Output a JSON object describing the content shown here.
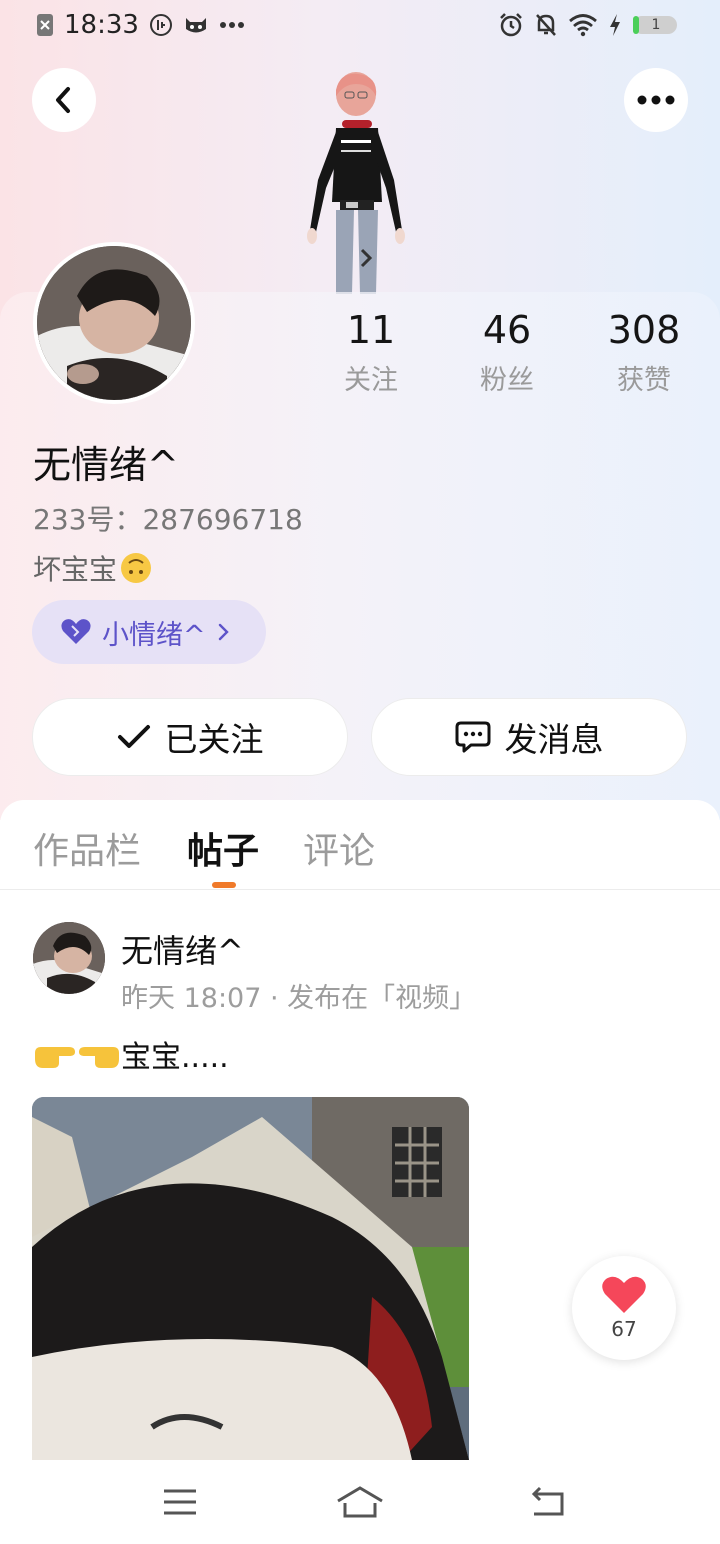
{
  "status_bar": {
    "time": "18:33",
    "battery_level": "1",
    "icons": [
      "close-square-icon",
      "app-icon",
      "cat-face-icon",
      "more-dots-icon",
      "alarm-icon",
      "bell-off-icon",
      "wifi-icon",
      "charging-icon",
      "battery-icon"
    ]
  },
  "profile": {
    "nickname": "无情绪^",
    "uid_text": "233号：287696718",
    "bio": "坏宝宝",
    "bio_emoji": "upside-down-face",
    "tag_label": "小情绪^",
    "stats": [
      {
        "value": "11",
        "label": "关注"
      },
      {
        "value": "46",
        "label": "粉丝"
      },
      {
        "value": "308",
        "label": "获赞"
      }
    ]
  },
  "actions": {
    "follow_label": "已关注",
    "message_label": "发消息"
  },
  "tabs": [
    {
      "label": "作品栏",
      "active": false
    },
    {
      "label": "帖子",
      "active": true
    },
    {
      "label": "评论",
      "active": false
    }
  ],
  "post": {
    "author": "无情绪^",
    "meta": "昨天 18:07 · 发布在「视频」",
    "text": "宝宝.....",
    "likes": "67"
  },
  "colors": {
    "accent_orange": "#f07a2a",
    "tag_purple": "#5d53c9",
    "like_red": "#f5475a"
  }
}
